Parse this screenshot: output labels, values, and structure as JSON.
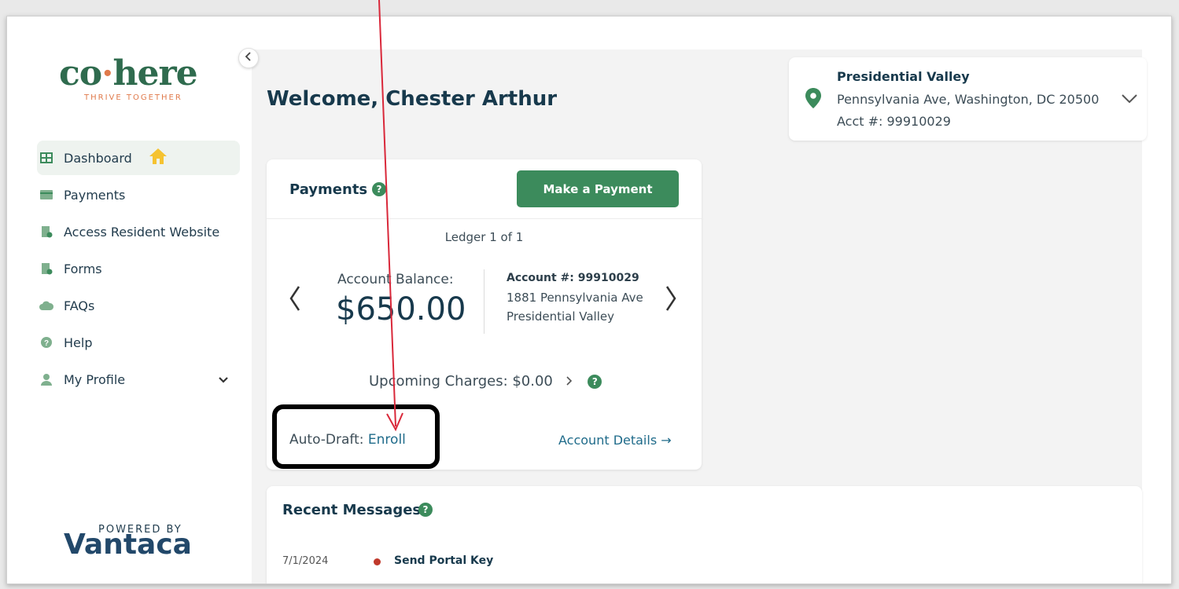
{
  "sidebar": {
    "logo": {
      "word_left": "co",
      "dot": "·",
      "word_right": "here",
      "tagline": "THRIVE TOGETHER"
    },
    "collapse_icon": "chevron-left-icon",
    "items": [
      {
        "label": "Dashboard",
        "icon": "grid-icon",
        "active": true
      },
      {
        "label": "Payments",
        "icon": "card-icon"
      },
      {
        "label": "Access Resident Website",
        "icon": "document-icon"
      },
      {
        "label": "Forms",
        "icon": "document-icon"
      },
      {
        "label": "FAQs",
        "icon": "cloud-icon"
      },
      {
        "label": "Help",
        "icon": "question-icon"
      },
      {
        "label": "My Profile",
        "icon": "user-icon",
        "expandable": true
      }
    ],
    "powered_by": {
      "small": "POWERED BY",
      "big": "Vantaca"
    }
  },
  "header": {
    "welcome": "Welcome, Chester Arthur"
  },
  "property": {
    "name": "Presidential Valley",
    "address": "Pennsylvania Ave, Washington, DC 20500",
    "account": "Acct #: 99910029"
  },
  "payments": {
    "title": "Payments",
    "make_payment_label": "Make a Payment",
    "ledger": "Ledger 1 of 1",
    "balance_label": "Account Balance:",
    "balance_value": "$650.00",
    "account_number": "Account #: 99910029",
    "address_line1": "1881 Pennsylvania Ave",
    "address_line2": "Presidential Valley",
    "upcoming": "Upcoming Charges: $0.00",
    "autodraft_label": "Auto-Draft:",
    "autodraft_link": "Enroll",
    "account_details": "Account Details →"
  },
  "messages": {
    "title": "Recent Messages",
    "items": [
      {
        "date": "7/1/2024",
        "subject": "Send Portal Key"
      }
    ]
  },
  "colors": {
    "brand_green": "#3c8b5c",
    "logo_orange": "#e07a4b",
    "link_blue": "#1f6b8a",
    "annotation_red": "#d9283a"
  }
}
